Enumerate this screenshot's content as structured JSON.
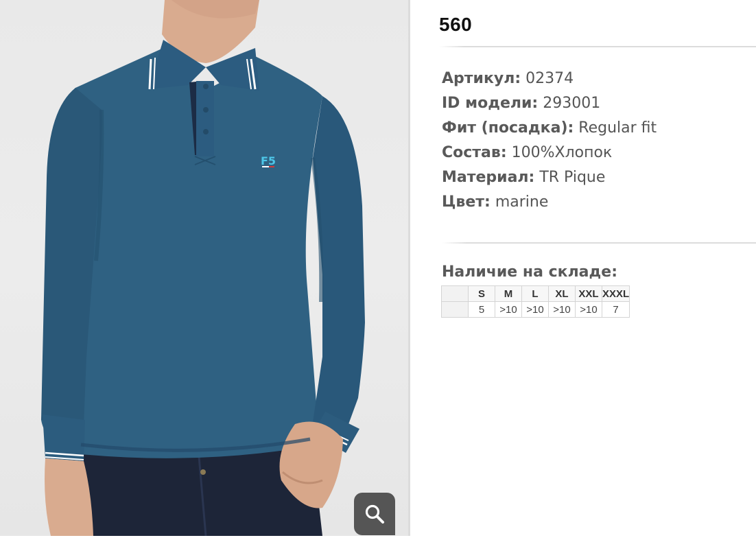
{
  "product": {
    "code": "560",
    "specs": [
      {
        "label": "Артикул:",
        "value": "02374"
      },
      {
        "label": "ID модели:",
        "value": "293001"
      },
      {
        "label": "Фит (посадка):",
        "value": "Regular fit"
      },
      {
        "label": "Состав:",
        "value": "100%Хлопок"
      },
      {
        "label": "Материал:",
        "value": "TR Pique"
      },
      {
        "label": "Цвет:",
        "value": "marine"
      }
    ]
  },
  "stock": {
    "title": "Наличие на складе:",
    "sizes": [
      "S",
      "M",
      "L",
      "XL",
      "XXL",
      "XXXL"
    ],
    "quantities": [
      "5",
      ">10",
      ">10",
      ">10",
      ">10",
      "7"
    ]
  },
  "photo": {
    "logo_text": "F5",
    "zoom_icon": "search-icon",
    "shirt_color": "#2f6182",
    "background_color": "#eaeaea"
  },
  "colors": {
    "text": "#555555",
    "heading": "#111111",
    "zoom_button": "#555555"
  }
}
